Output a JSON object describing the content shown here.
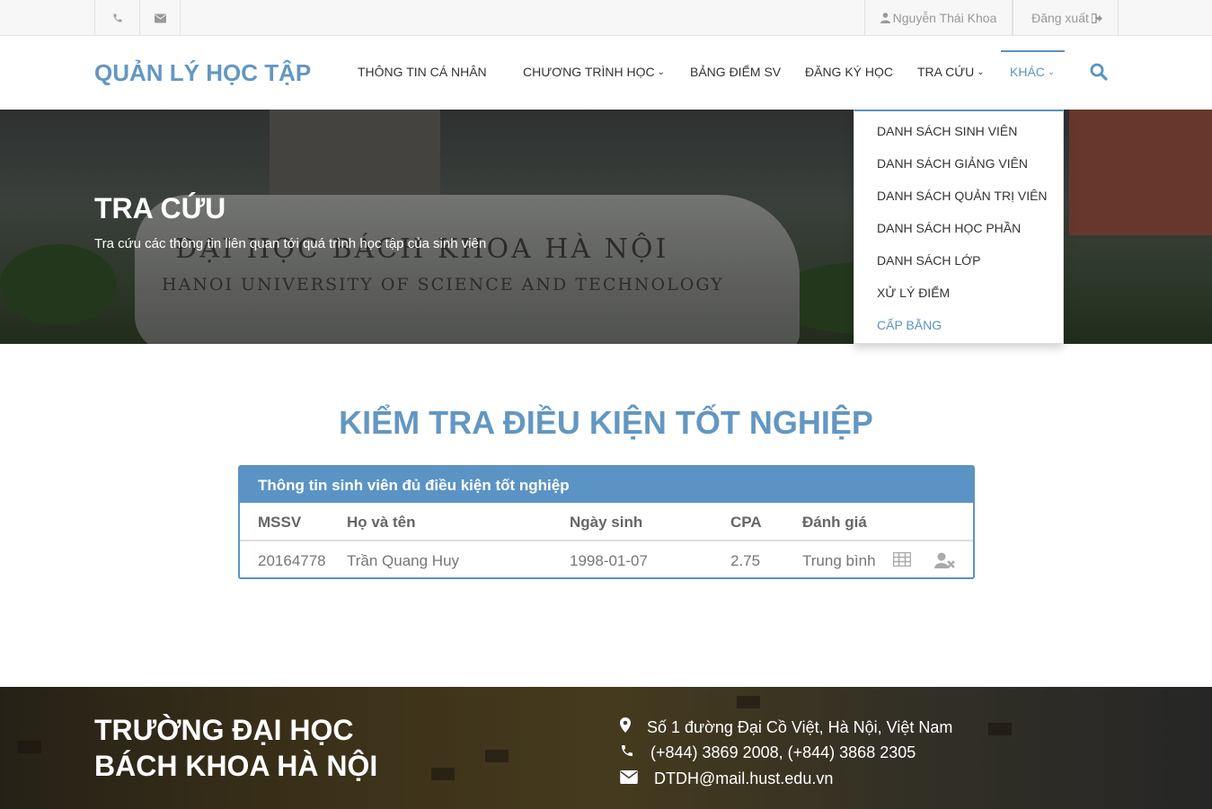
{
  "topbar": {
    "phone_icon": "phone-icon",
    "mail_icon": "envelope-icon",
    "user_name": "Nguyễn Thái Khoa",
    "logout_label": "Đăng xuất"
  },
  "nav": {
    "brand": "QUẢN LÝ HỌC TẬP",
    "items": [
      {
        "label": "THÔNG TIN CÁ NHÂN"
      },
      {
        "label": "CHƯƠNG TRÌNH HỌC"
      },
      {
        "label": "BẢNG ĐIỂM SV"
      },
      {
        "label": "ĐĂNG KÝ HỌC"
      },
      {
        "label": "TRA CỨU"
      },
      {
        "label": "KHÁC"
      }
    ],
    "active_color": "#5b93c4"
  },
  "dropdown": {
    "items": [
      {
        "label": "DANH SÁCH SINH VIÊN"
      },
      {
        "label": "DANH SÁCH GIẢNG VIÊN"
      },
      {
        "label": "DANH SÁCH QUẢN TRỊ VIÊN"
      },
      {
        "label": "DANH SÁCH HỌC PHẦN"
      },
      {
        "label": "DANH SÁCH LỚP"
      },
      {
        "label": "XỬ LÝ ĐIỂM"
      },
      {
        "label": "CẤP BẰNG"
      }
    ]
  },
  "hero": {
    "title": "TRA CỨU",
    "subtitle": "Tra cứu các thông tin liên quan tới quá trình học tập của sinh viên",
    "stone_line1": "ĐẠI HỌC BÁCH KHOA HÀ NỘI",
    "stone_line2": "HANOI UNIVERSITY OF SCIENCE AND TECHNOLOGY"
  },
  "main": {
    "title": "KIỂM TRA ĐIỀU KIỆN TỐT NGHIỆP",
    "panel_title": "Thông tin sinh viên đủ điều kiện tốt nghiệp",
    "columns": [
      "MSSV",
      "Họ và tên",
      "Ngày sinh",
      "CPA",
      "Đánh giá"
    ],
    "rows": [
      {
        "mssv": "20164778",
        "name": "Trần Quang Huy",
        "dob": "1998-01-07",
        "cpa": "2.75",
        "rating": "Trung bình"
      }
    ]
  },
  "footer": {
    "title_line1": "TRƯỜNG ĐẠI HỌC",
    "title_line2": "BÁCH KHOA HÀ NỘI",
    "address": "Số 1 đường Đại Cồ Việt, Hà Nội, Việt Nam",
    "phone": "(+844) 3869 2008, (+844) 3868 2305",
    "email": "DTDH@mail.hust.edu.vn"
  }
}
